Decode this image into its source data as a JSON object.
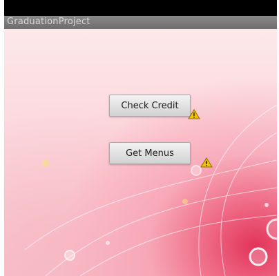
{
  "app": {
    "title": "GraduationProject"
  },
  "buttons": {
    "check_credit": "Check Credit",
    "get_menus": "Get Menus"
  },
  "icons": {
    "warning": "warning-icon"
  },
  "colors": {
    "status_bar": "#000000",
    "title_bar": "#7c7c7c",
    "title_text": "#d8d8d8",
    "background_top": "#fde8ea",
    "background_accent": "#e2345a",
    "button_face": "#e2e2e2",
    "warning": "#f2c200"
  }
}
